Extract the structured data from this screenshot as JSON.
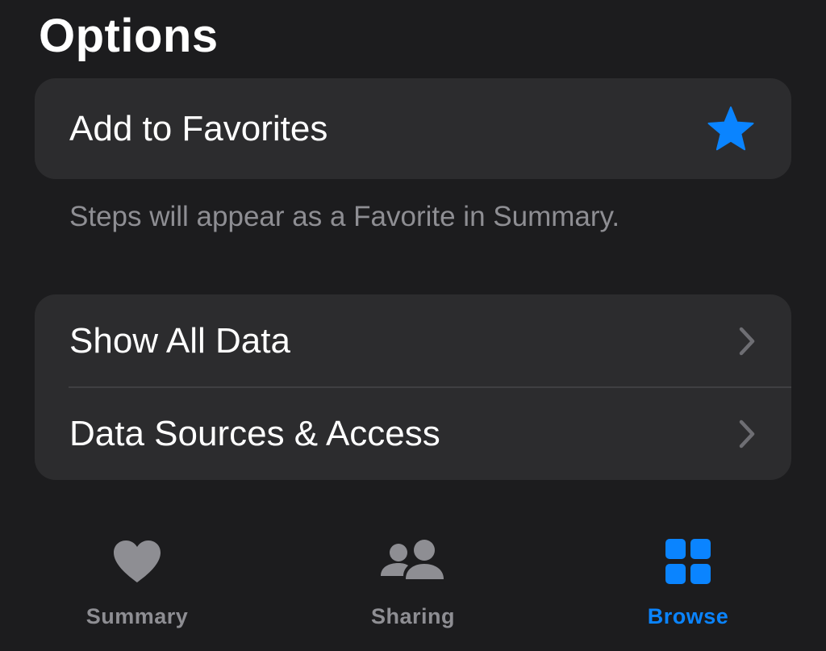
{
  "section": {
    "title": "Options"
  },
  "favorites": {
    "label": "Add to Favorites",
    "icon": "star-icon",
    "footnote": "Steps will appear as a Favorite in Summary."
  },
  "data_options": {
    "items": [
      {
        "label": "Show All Data",
        "icon": "chevron-right-icon"
      },
      {
        "label": "Data Sources & Access",
        "icon": "chevron-right-icon"
      }
    ]
  },
  "tabbar": {
    "tabs": [
      {
        "label": "Summary",
        "icon": "heart-icon",
        "active": false
      },
      {
        "label": "Sharing",
        "icon": "people-icon",
        "active": false
      },
      {
        "label": "Browse",
        "icon": "grid-icon",
        "active": true
      }
    ]
  },
  "colors": {
    "background": "#1c1c1e",
    "card": "#2c2c2e",
    "accent": "#0a84ff",
    "secondary_text": "#8e8e93",
    "inactive_tab": "#8e8e93"
  }
}
